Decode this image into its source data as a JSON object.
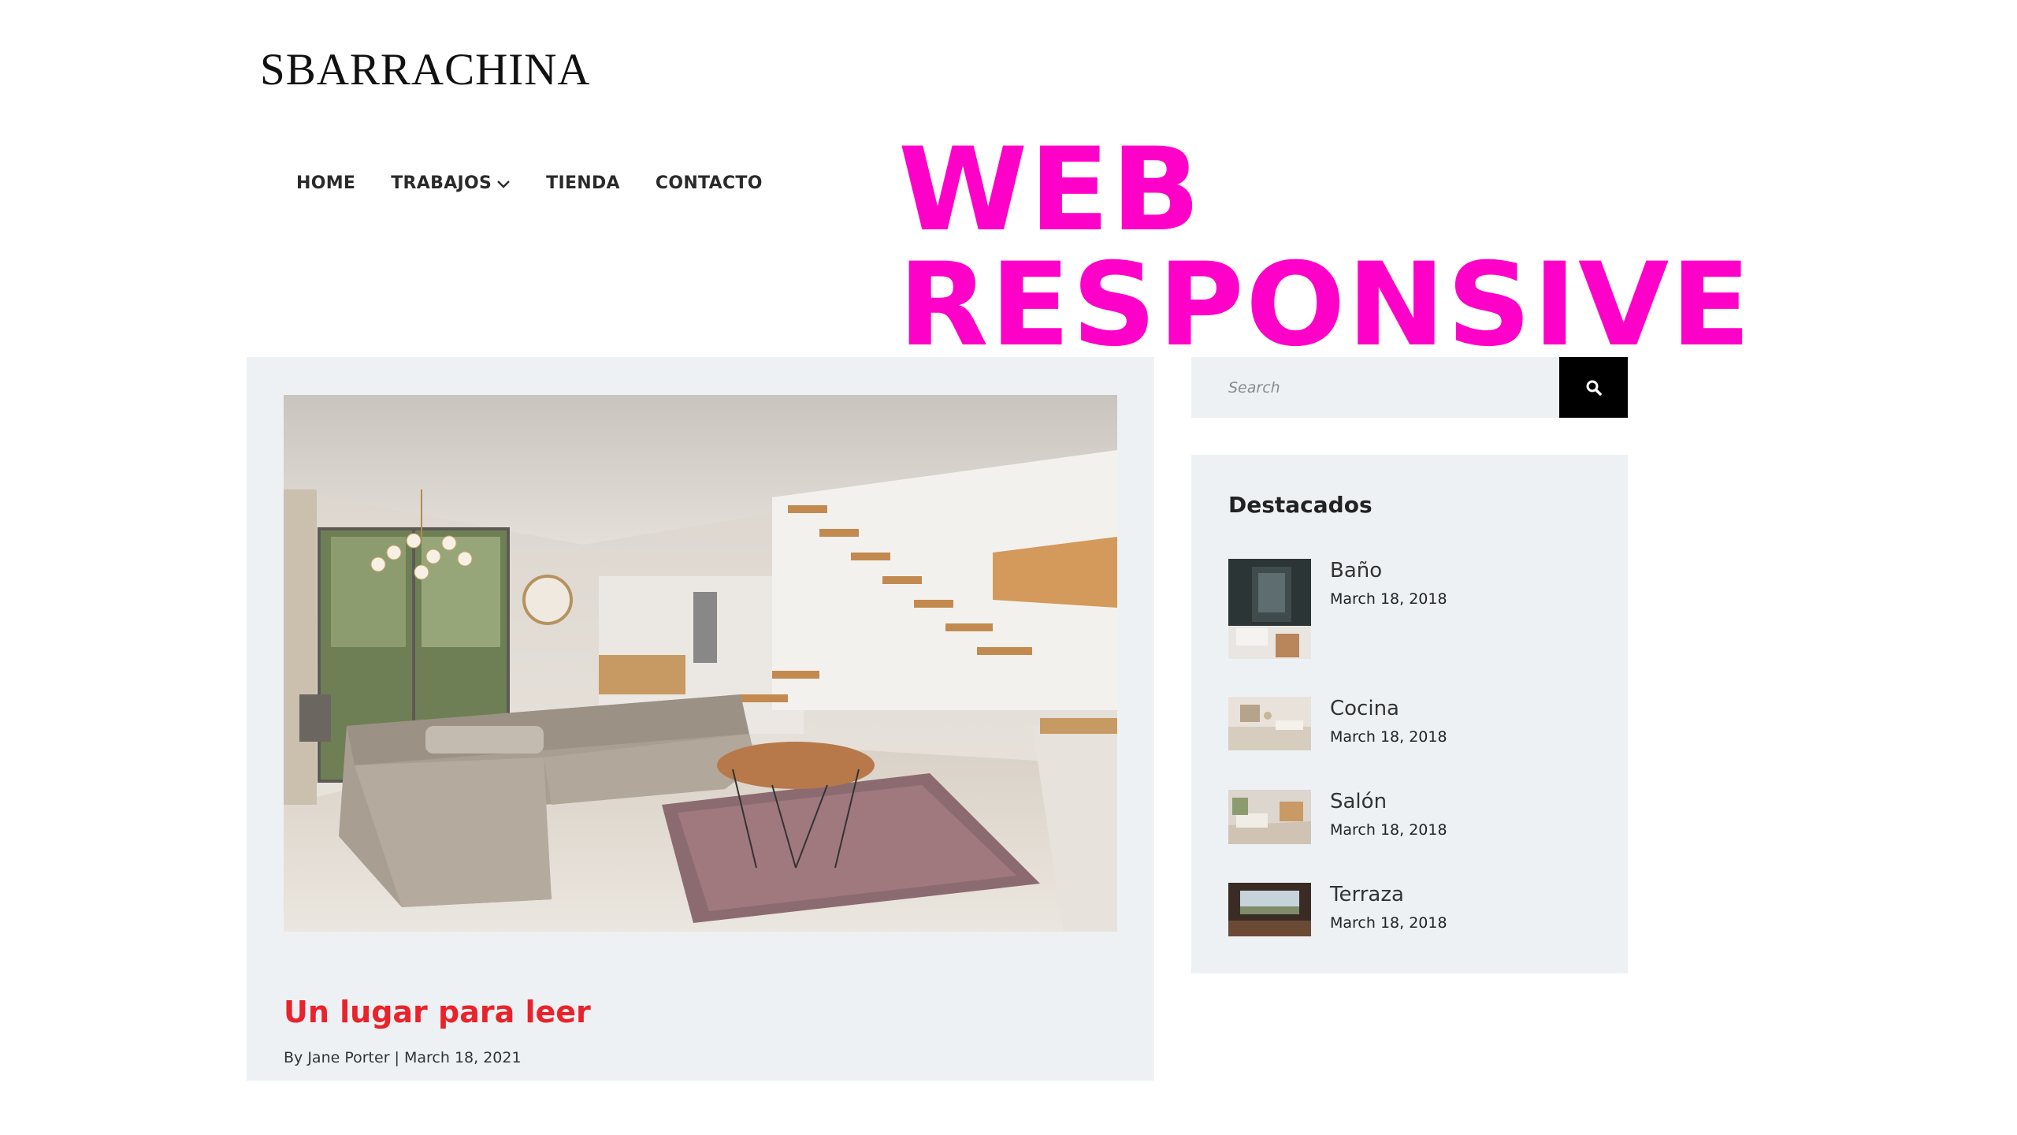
{
  "site": {
    "title": "SBARRACHINA"
  },
  "nav": {
    "items": [
      {
        "label": "HOME"
      },
      {
        "label": "TRABAJOS",
        "has_dropdown": true
      },
      {
        "label": "TIENDA"
      },
      {
        "label": "CONTACTO"
      }
    ]
  },
  "promo": {
    "text": "WEB RESPONSIVE",
    "color": "#ff00c8"
  },
  "post": {
    "title": "Un lugar para leer",
    "meta": "By Jane Porter | March 18, 2021",
    "title_color": "#e8232b"
  },
  "search": {
    "placeholder": "Search",
    "button_icon": "search-icon"
  },
  "featured": {
    "heading": "Destacados",
    "items": [
      {
        "title": "Baño",
        "date": "March 18, 2018"
      },
      {
        "title": "Cocina",
        "date": "March 18, 2018"
      },
      {
        "title": "Salón",
        "date": "March 18, 2018"
      },
      {
        "title": "Terraza",
        "date": "March 18, 2018"
      }
    ]
  },
  "colors": {
    "card_bg": "#eef1f4",
    "accent": "#e8232b",
    "promo": "#ff00c8"
  }
}
